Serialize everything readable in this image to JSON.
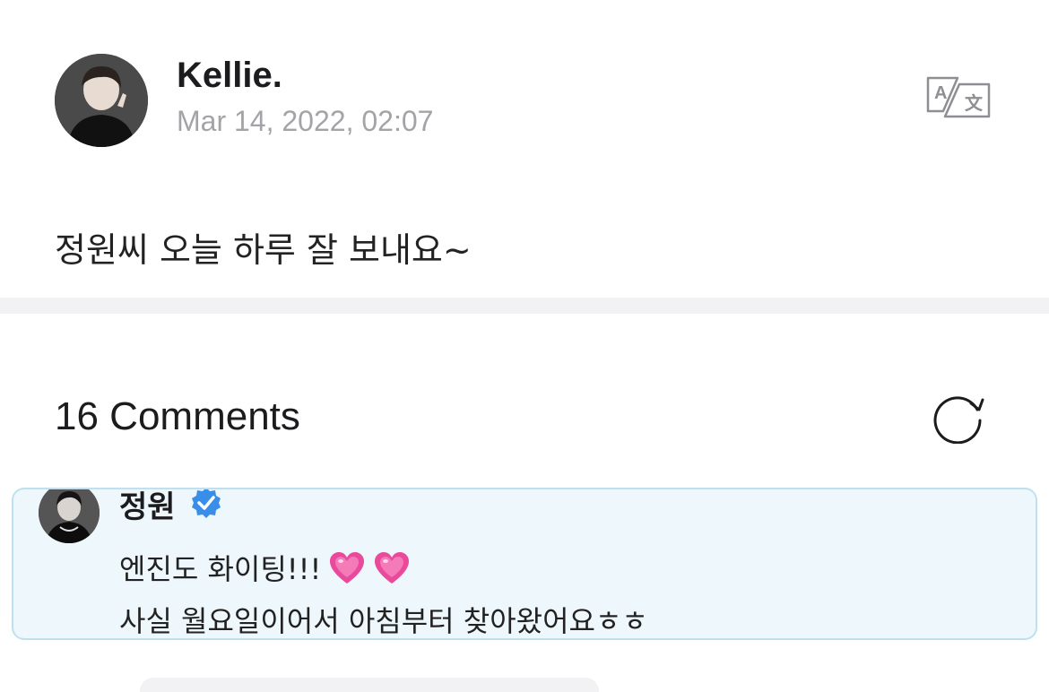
{
  "post": {
    "author": "Kellie.",
    "date": "Mar 14, 2022, 02:07",
    "body": "정원씨 오늘 하루 잘 보내요~",
    "avatar_icon": "profile-photo",
    "translate_icon": "translate-icon"
  },
  "comments": {
    "title": "16 Comments",
    "refresh_icon": "refresh-icon",
    "items": [
      {
        "author": "정원",
        "verified": true,
        "line1": "엔진도 화이팅!!!",
        "emoji": [
          "growing-heart",
          "growing-heart"
        ],
        "line2": "사실 월요일이어서 아침부터 찾아왔어요ㅎㅎ",
        "highlight_color": "#eef7fc"
      }
    ]
  },
  "colors": {
    "accent": "#3b8ee8",
    "muted_text": "#a3a3a8",
    "heart": "#e94a9b"
  }
}
